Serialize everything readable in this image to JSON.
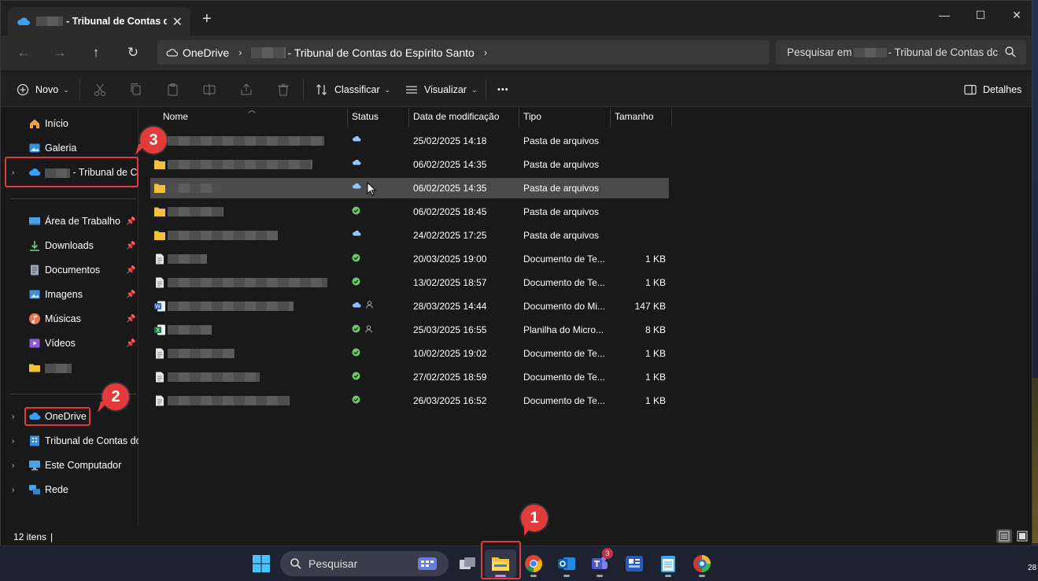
{
  "tab": {
    "title": "- Tribunal de Contas do"
  },
  "window_controls": {
    "minimize": "—",
    "maximize": "☐",
    "close": "✕"
  },
  "breadcrumb": {
    "root": "OneDrive",
    "folder": "- Tribunal de Contas do Espírito Santo"
  },
  "search": {
    "placeholder_prefix": "Pesquisar em",
    "placeholder_suffix": "- Tribunal de Contas dc"
  },
  "toolbar": {
    "new_label": "Novo",
    "sort_label": "Classificar",
    "view_label": "Visualizar",
    "more_label": "•••",
    "details_label": "Detalhes"
  },
  "sidebar": {
    "quick": [
      {
        "label": "Início",
        "icon": "home-icon"
      },
      {
        "label": "Galeria",
        "icon": "gallery-icon"
      }
    ],
    "onedrive_business": {
      "label": "- Tribunal de Co"
    },
    "pinned": [
      {
        "label": "Área de Trabalho",
        "icon": "desktop-icon"
      },
      {
        "label": "Downloads",
        "icon": "download-icon"
      },
      {
        "label": "Documentos",
        "icon": "documents-icon"
      },
      {
        "label": "Imagens",
        "icon": "pictures-icon"
      },
      {
        "label": "Músicas",
        "icon": "music-icon"
      },
      {
        "label": "Vídeos",
        "icon": "videos-icon"
      }
    ],
    "bottom": [
      {
        "label": "OneDrive",
        "icon": "onedrive-icon"
      },
      {
        "label": "Tribunal de Contas do",
        "icon": "building-icon"
      },
      {
        "label": "Este Computador",
        "icon": "computer-icon"
      },
      {
        "label": "Rede",
        "icon": "network-icon"
      }
    ]
  },
  "columns": {
    "name": "Nome",
    "status": "Status",
    "modified": "Data de modificação",
    "type": "Tipo",
    "size": "Tamanho"
  },
  "files": [
    {
      "date": "25/02/2025 14:18",
      "type": "Pasta de arquivos",
      "size": "",
      "kind": "folder",
      "status": "cloud"
    },
    {
      "date": "06/02/2025 14:35",
      "type": "Pasta de arquivos",
      "size": "",
      "kind": "folder",
      "status": "cloud"
    },
    {
      "date": "06/02/2025 14:35",
      "type": "Pasta de arquivos",
      "size": "",
      "kind": "folder",
      "status": "cloud"
    },
    {
      "date": "06/02/2025 18:45",
      "type": "Pasta de arquivos",
      "size": "",
      "kind": "folder",
      "status": "synced"
    },
    {
      "date": "24/02/2025 17:25",
      "type": "Pasta de arquivos",
      "size": "",
      "kind": "folder",
      "status": "cloud"
    },
    {
      "date": "20/03/2025 19:00",
      "type": "Documento de Te...",
      "size": "1 KB",
      "kind": "text",
      "status": "synced"
    },
    {
      "date": "13/02/2025 18:57",
      "type": "Documento de Te...",
      "size": "1 KB",
      "kind": "text",
      "status": "synced"
    },
    {
      "date": "28/03/2025 14:44",
      "type": "Documento do Mi...",
      "size": "147 KB",
      "kind": "word",
      "status": "cloud-shared"
    },
    {
      "date": "25/03/2025 16:55",
      "type": "Planilha do Micro...",
      "size": "8 KB",
      "kind": "excel",
      "status": "synced-shared"
    },
    {
      "date": "10/02/2025 19:02",
      "type": "Documento de Te...",
      "size": "1 KB",
      "kind": "text",
      "status": "synced"
    },
    {
      "date": "27/02/2025 18:59",
      "type": "Documento de Te...",
      "size": "1 KB",
      "kind": "text",
      "status": "synced"
    },
    {
      "date": "26/03/2025 16:52",
      "type": "Documento de Te...",
      "size": "1 KB",
      "kind": "text",
      "status": "synced"
    }
  ],
  "statusbar": {
    "count": "12 itens",
    "sep": "|"
  },
  "taskbar": {
    "search_label": "Pesquisar",
    "teams_badge": "3",
    "clock_partial": "28"
  },
  "annotations": [
    "1",
    "2",
    "3"
  ],
  "colors": {
    "accent_red": "#e23b3b",
    "cloud_blue": "#8ec5ff",
    "synced_green": "#6ccb5f",
    "folder_yellow": "#f3c03c"
  }
}
